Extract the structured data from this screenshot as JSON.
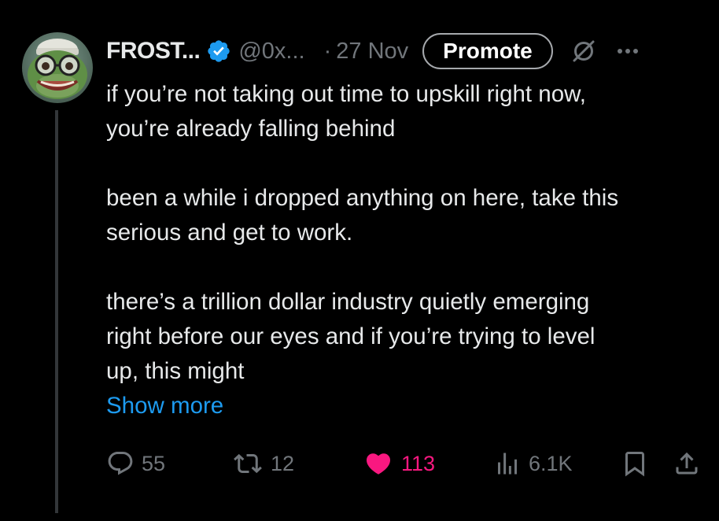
{
  "author": {
    "display_name": "FROST...",
    "handle": "@0x...",
    "separator": "·",
    "date": "27 Nov"
  },
  "header_actions": {
    "promote_label": "Promote"
  },
  "tweet": {
    "paragraphs": [
      "if you’re not taking out time to upskill right now,\nyou’re already falling behind",
      "been a while i dropped anything on here, take this\nserious and get to work.",
      "there’s a trillion dollar industry quietly emerging\nright before our eyes and if you’re trying to level\nup, this might"
    ],
    "show_more_label": "Show more"
  },
  "engagement": {
    "replies": "55",
    "reposts": "12",
    "likes": "113",
    "views": "6.1K",
    "liked": true
  },
  "colors": {
    "background": "#000000",
    "text": "#e7e9ea",
    "secondary_text": "#71767b",
    "link": "#1d9bf0",
    "like": "#f91880",
    "verified": "#1d9bf0",
    "thread_line": "#333639"
  },
  "icons": {
    "verified": "verified-badge-icon",
    "grok": "grok-icon",
    "more": "more-horizontal-icon",
    "reply": "reply-icon",
    "repost": "repost-icon",
    "like": "heart-filled-icon",
    "views": "views-chart-icon",
    "bookmark": "bookmark-icon",
    "share": "share-icon"
  }
}
